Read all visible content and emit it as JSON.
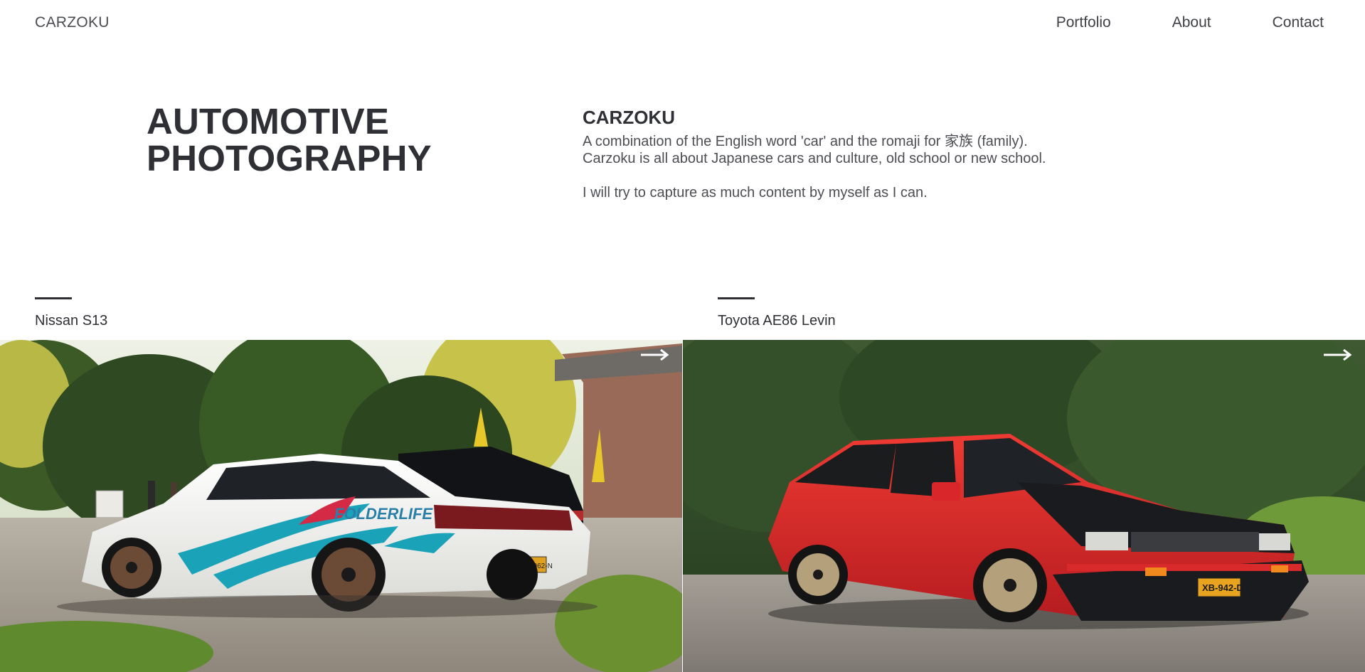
{
  "header": {
    "logo": "CARZOKU",
    "nav": [
      {
        "label": "Portfolio"
      },
      {
        "label": "About"
      },
      {
        "label": "Contact"
      }
    ]
  },
  "hero": {
    "title_line1": "AUTOMOTIVE",
    "title_line2": "PHOTOGRAPHY"
  },
  "about": {
    "heading": "CARZOKU",
    "line1": "A combination of the English word 'car' and the romaji for 家族 (family).",
    "line2": "Carzoku is all about Japanese cars and culture, old school or new school.",
    "line3": "I will try to capture as much content by myself as I can."
  },
  "gallery": [
    {
      "title": "Nissan S13",
      "icon": "arrow-right-icon",
      "plates": [
        "XT-962-N",
        "FOLDERLIFE"
      ]
    },
    {
      "title": "Toyota AE86 Levin",
      "icon": "arrow-right-icon",
      "plates": [
        "XB-942-D"
      ]
    }
  ],
  "colors": {
    "text": "#2e3035",
    "muted": "#4c4e54",
    "background": "#ffffff",
    "s13_body": "#f2f2f0",
    "ae86_body": "#d8262a",
    "foliage": "#2f4a22"
  }
}
